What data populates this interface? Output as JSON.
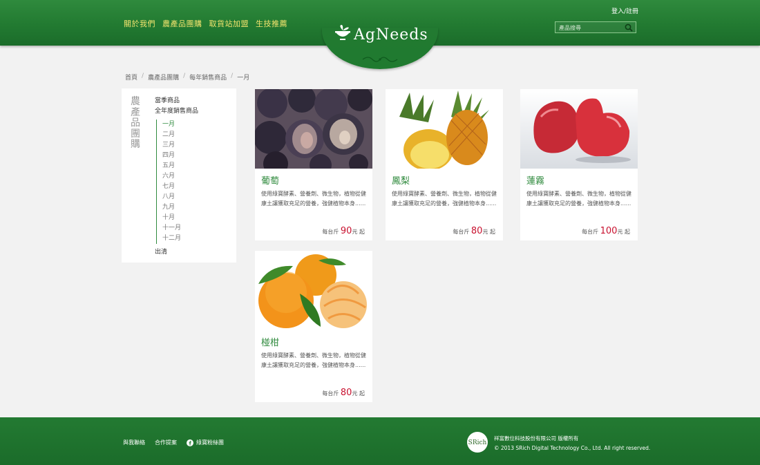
{
  "header": {
    "nav": [
      "關於我們",
      "農產品團購",
      "取貨站加盟",
      "生技推薦"
    ],
    "login": "登入/註冊",
    "search_placeholder": "產品搜尋",
    "logo": "AgNeeds"
  },
  "breadcrumb": [
    "首頁",
    "農產品團購",
    "每年銷售商品",
    "一月"
  ],
  "sidebar": {
    "title": "農產品團購",
    "seasonal": "當季商品",
    "yearly": "全年度銷售商品",
    "months": [
      "一月",
      "二月",
      "三月",
      "四月",
      "五月",
      "六月",
      "七月",
      "八月",
      "九月",
      "十月",
      "十一月",
      "十二月"
    ],
    "active_month": "一月",
    "clearance": "出清"
  },
  "products": [
    {
      "name": "葡萄",
      "desc": "使用綠寶酵素、營養劑、微生物，植物從健康土讓獲取充足的營養，強健植物本身......",
      "price_prefix": "每台斤",
      "price": "90",
      "price_suffix": "元 起"
    },
    {
      "name": "鳳梨",
      "desc": "使用綠寶酵素、營養劑、微生物，植物從健康土讓獲取充足的營養，強健植物本身......",
      "price_prefix": "每台斤",
      "price": "80",
      "price_suffix": "元 起"
    },
    {
      "name": "蓮霧",
      "desc": "使用綠寶酵素、營養劑、微生物，植物從健康土讓獲取充足的營養，強健植物本身......",
      "price_prefix": "每台斤",
      "price": "100",
      "price_suffix": "元 起"
    },
    {
      "name": "椪柑",
      "desc": "使用綠寶酵素、營養劑、微生物，植物從健康土讓獲取充足的營養，強健植物本身......",
      "price_prefix": "每台斤",
      "price": "80",
      "price_suffix": "元 起"
    }
  ],
  "footer": {
    "links": [
      "與我聯絡",
      "合作提案",
      "綠寶粉絲團"
    ],
    "company_line1": "祥富數位科技股份有限公司 版權所有",
    "company_line2": "© 2013 SRich Digital Technology Co., Ltd. All right reserved.",
    "logo_text": "SRich"
  },
  "colors": {
    "brand_green": "#227a31",
    "accent_yellow": "#f1e36e",
    "price_red": "#c8102e"
  }
}
